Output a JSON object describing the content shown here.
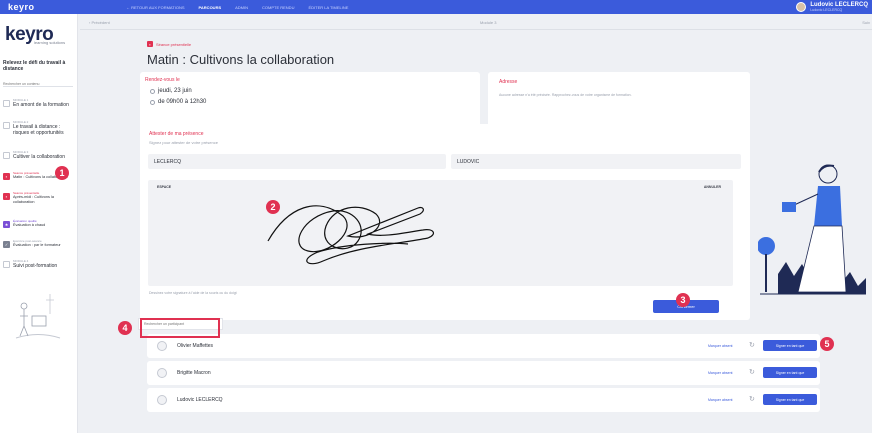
{
  "topbar": {
    "logo": "keyro",
    "nav": [
      "← RETOUR AUX FORMATIONS",
      "PARCOURS",
      "ADMIN",
      "COMPTE RENDU",
      "ÉDITER LA TIMELINE"
    ],
    "user_name": "Ludovic LECLERCQ",
    "user_sub": "Ludovic LECLERCQ"
  },
  "sidebar": {
    "brand": "keyro",
    "brand_sub": "learning solutions",
    "program_title": "Relevez le défi du travail à distance",
    "search_placeholder": "Rechercher un contenu",
    "items": [
      {
        "small": "MODULE 1",
        "label": "En amont de la formation"
      },
      {
        "small": "MODULE 2",
        "label": "Le travail à distance : risques et opportunités"
      },
      {
        "small": "MODULE 3",
        "label": "Cultiver la collaboration"
      },
      {
        "small": "Séance présentielle",
        "label": "Matin : Cultivons la collaboration"
      },
      {
        "small": "Séance présentielle",
        "label": "Après-midi : Cultivons la collaboration"
      },
      {
        "small": "Évaluation qualité",
        "label": "Évaluation à chaud"
      },
      {
        "small": "Exercice post-séance",
        "label": "Évaluation : par le formateur"
      },
      {
        "small": "MODULE 4",
        "label": "Suivi post-formation"
      }
    ]
  },
  "pager": {
    "previous": "‹  Précédent",
    "module": "Module 3",
    "next": "Suiv"
  },
  "session": {
    "type": "Séance présentielle",
    "title": "Matin : Cultivons la collaboration"
  },
  "rendezvous": {
    "title": "Rendez-vous le",
    "date": "jeudi, 23 juin",
    "time": "de 09h00 à 12h30"
  },
  "address": {
    "title": "Adresse",
    "text": "Aucune adresse n'a été précisée. Rapprochez-vous de votre organisme de formation."
  },
  "attendance": {
    "title": "Attester de ma présence",
    "subtitle": "Signez pour attester de votre présence",
    "lastname": "LECLERCQ",
    "firstname": "LUDOVIC",
    "pad_label": "ESPACE",
    "clear_label": "ANNULER",
    "hint": "Dessinez votre signature à l'aide de la souris ou du doigt",
    "confirm": "Confirmer"
  },
  "participants": {
    "search_placeholder": "Rechercher un participant",
    "absent_label": "Marquer absent",
    "sign_label": "Signer en tant que",
    "list": [
      {
        "name": "Olivier Maffettes"
      },
      {
        "name": "Brigitte Macron"
      },
      {
        "name": "Ludovic LECLERCQ"
      }
    ]
  },
  "annotations": [
    "1",
    "2",
    "3",
    "4",
    "5"
  ],
  "colors": {
    "brand": "#3b5bdb",
    "accent": "#e03151",
    "violet": "#7a4fd6"
  }
}
